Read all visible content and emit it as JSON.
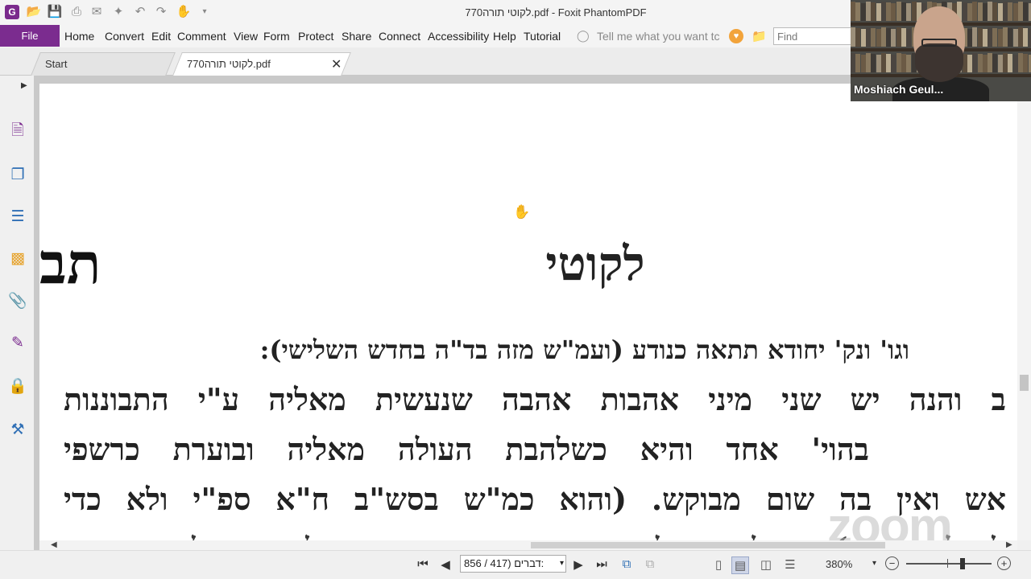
{
  "window_title": "770לקוטי תורה.pdf - Foxit PhantomPDF",
  "menu": {
    "file": "File",
    "items": [
      "Home",
      "Convert",
      "Edit",
      "Comment",
      "View",
      "Form",
      "Protect",
      "Share",
      "Connect",
      "Accessibility",
      "Help",
      "Tutorial"
    ],
    "tell_me": "Tell me what you want tc",
    "find_placeholder": "Find"
  },
  "tabs": [
    {
      "label": "Start",
      "active": false
    },
    {
      "label": "770לקוטי תורה.pdf",
      "active": true
    }
  ],
  "document": {
    "heading": "לקוטי",
    "heading_edge": "תב",
    "lines": [
      "וגו' ונק' יחודא תתאה כנודע (ועמ\"ש מזה בד\"ה בחדש השלישי):",
      "ב והנה יש שני מיני אהבות אהבה שנעשית מאליה ע\"י התבוננות",
      "בהוי' אחד והיא כשלהבת העולה מאליה ובוערת כרשפי",
      "אש ואין בה שום מבוקש. (והוא כמ\"ש בסש\"ב ח\"א ספ\"י ולא כדי",
      "לקבל פרס) הלכה לאהוב שעשוי יהיה לה. שלא ויהיה"
    ],
    "watermark": "zoom"
  },
  "statusbar": {
    "page_indicator": "85דברים (417 / 6:",
    "zoom_level": "380%",
    "zoom_fraction": 0.66
  },
  "video": {
    "participant_name": "Moshiach Geul..."
  },
  "colors": {
    "brand_purple": "#7b2c8f",
    "active_view": "#cfd6e8"
  }
}
